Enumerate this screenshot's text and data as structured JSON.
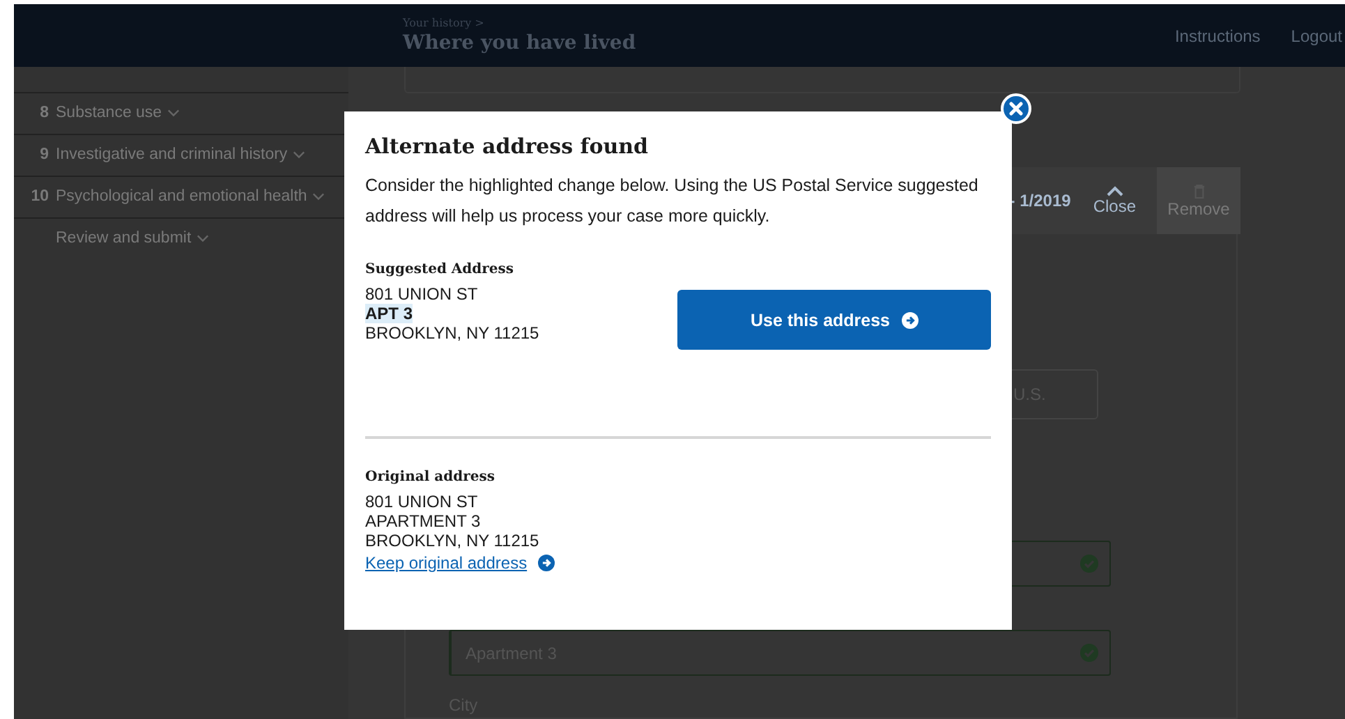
{
  "header": {
    "breadcrumb": "Your history >",
    "title": "Where you have lived",
    "links": [
      "Instructions",
      "Logout"
    ]
  },
  "sidebar": {
    "items": [
      {
        "number": "8",
        "label": "Substance use",
        "expandable": true
      },
      {
        "number": "9",
        "label": "Investigative and criminal history",
        "expandable": true
      },
      {
        "number": "10",
        "label": "Psychological and emotional health",
        "expandable": true
      },
      {
        "label": "Review and submit",
        "expandable": true
      }
    ]
  },
  "background": {
    "date_range": "- 1/2019",
    "close": "Close",
    "remove": "Remove",
    "country_field": "U.S.",
    "fields": [
      {
        "valid": true
      },
      {
        "value": "Apartment 3",
        "valid": true
      }
    ],
    "city_label": "City"
  },
  "modal": {
    "title": "Alternate address found",
    "message": "Consider the highlighted change below. Using the US Postal Service suggested address will help us process your case more quickly.",
    "suggested": {
      "heading": "Suggested Address",
      "lines": [
        {
          "text": "801 UNION ST",
          "highlighted": false
        },
        {
          "text": "APT 3",
          "highlighted": true
        },
        {
          "text": "BROOKLYN, NY 11215",
          "highlighted": false
        }
      ]
    },
    "use_button": "Use this address",
    "original": {
      "heading": "Original address",
      "lines": [
        {
          "text": "801 UNION ST",
          "highlighted": false
        },
        {
          "text": "APARTMENT 3",
          "highlighted": false
        },
        {
          "text": "BROOKLYN, NY 11215",
          "highlighted": false
        }
      ],
      "link": "Keep original address"
    }
  }
}
